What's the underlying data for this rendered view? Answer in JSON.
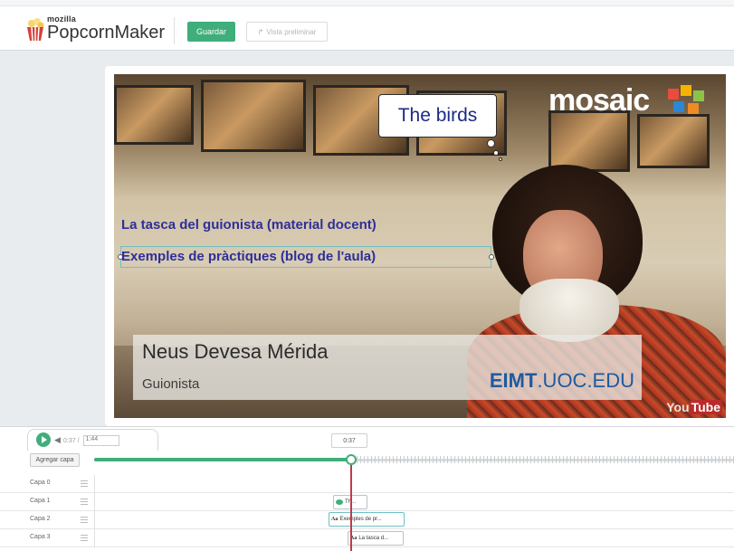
{
  "header": {
    "brand_small": "mozilla",
    "brand_main": "PopcornMaker",
    "save_label": "Guardar",
    "preview_label": "Vista preliminar"
  },
  "video": {
    "bubble_text": "The birds",
    "mosaic_logo_text": "mosaic",
    "link_1": "La tasca del guionista (material docent)",
    "link_2": "Exemples de pràctiques (blog de l'aula)",
    "lower_third_name": "Neus Devesa Mérida",
    "lower_third_role": "Guionista",
    "brand_bold": "EIMT",
    "brand_rest": ".UOC.EDU",
    "youtube_logo": "You",
    "youtube_logo_tube": "Tube"
  },
  "timeline": {
    "current_time": "0:37",
    "duration": "1:44",
    "time_separator": "/",
    "playhead_label": "0:37",
    "add_layer_label": "Agregar capa",
    "progress_fraction": 0.36,
    "layers": [
      {
        "label": "Capa 0"
      },
      {
        "label": "Capa 1"
      },
      {
        "label": "Capa 2"
      },
      {
        "label": "Capa 3"
      }
    ],
    "events": {
      "layer1_event": "Th...",
      "layer2_event": "Exemples de pr...",
      "layer3_event": "La tasca d...",
      "text_icon_glyph": "Aa"
    }
  },
  "colors": {
    "accent": "#3fae7a",
    "playhead": "#c0394b",
    "overlay_text": "#2d2f9a",
    "brand_blue": "#1e5aa0"
  }
}
